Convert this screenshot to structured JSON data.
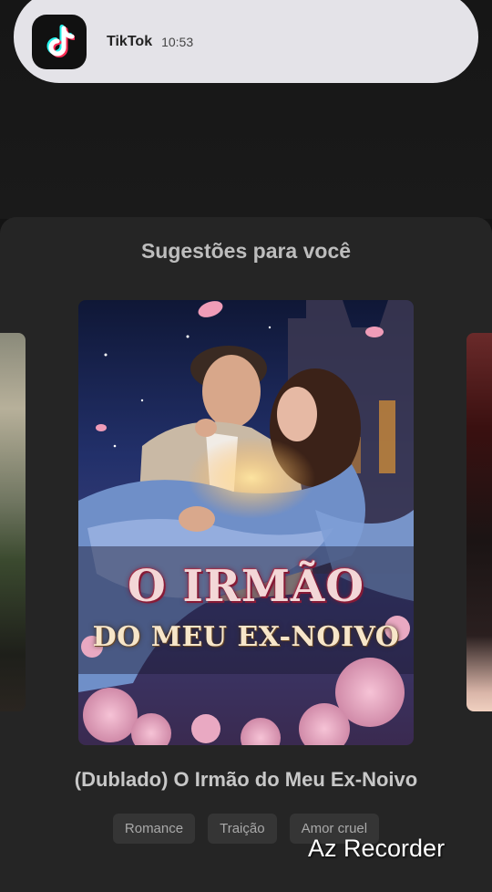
{
  "notification": {
    "app": "TikTok",
    "time": "10:53",
    "icon": "tiktok-logo-icon"
  },
  "sheet": {
    "title": "Sugestões para você"
  },
  "poster": {
    "title_line1": "O IRMÃO",
    "title_line2": "DO MEU EX-NOIVO"
  },
  "drama": {
    "title": "(Dublado) O Irmão do Meu Ex-Noivo",
    "tags": [
      "Romance",
      "Traição",
      "Amor cruel"
    ]
  },
  "watermark": "Az Recorder"
}
